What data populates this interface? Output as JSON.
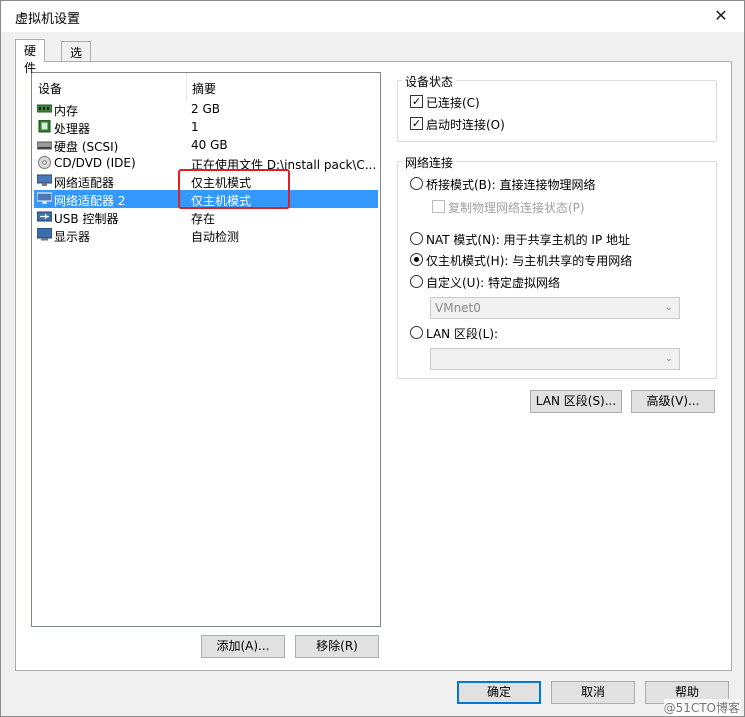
{
  "window": {
    "title": "虚拟机设置",
    "close_glyph": "✕"
  },
  "tabs": [
    {
      "label": "硬件",
      "active": true
    },
    {
      "label": "选项",
      "active": false
    }
  ],
  "device_list": {
    "columns": {
      "device": "设备",
      "summary": "摘要"
    },
    "rows": [
      {
        "name": "内存",
        "summary": "2 GB",
        "icon": "memory-icon"
      },
      {
        "name": "处理器",
        "summary": "1",
        "icon": "processor-icon"
      },
      {
        "name": "硬盘 (SCSI)",
        "summary": "40 GB",
        "icon": "hard-disk-icon"
      },
      {
        "name": "CD/DVD (IDE)",
        "summary": "正在使用文件 D:\\install pack\\C...",
        "icon": "cd-dvd-icon"
      },
      {
        "name": "网络适配器",
        "summary": "仅主机模式",
        "icon": "network-adapter-icon"
      },
      {
        "name": "网络适配器 2",
        "summary": "仅主机模式",
        "icon": "network-adapter-icon",
        "selected": true
      },
      {
        "name": "USB 控制器",
        "summary": "存在",
        "icon": "usb-icon"
      },
      {
        "name": "显示器",
        "summary": "自动检测",
        "icon": "display-icon"
      }
    ],
    "add_button": "添加(A)...",
    "remove_button": "移除(R)"
  },
  "device_status": {
    "title": "设备状态",
    "connected": {
      "label": "已连接(C)",
      "checked": true
    },
    "connect_at_power_on": {
      "label": "启动时连接(O)",
      "checked": true
    }
  },
  "network_connection": {
    "title": "网络连接",
    "bridged": {
      "label": "桥接模式(B): 直接连接物理网络",
      "selected": false
    },
    "replicate": {
      "label": "复制物理网络连接状态(P)",
      "checked": false
    },
    "nat": {
      "label": "NAT 模式(N): 用于共享主机的 IP 地址",
      "selected": false
    },
    "host_only": {
      "label": "仅主机模式(H): 与主机共享的专用网络",
      "selected": true
    },
    "custom": {
      "label": "自定义(U): 特定虚拟网络",
      "selected": false
    },
    "custom_value": "VMnet0",
    "lan_segment": {
      "label": "LAN 区段(L):",
      "selected": false
    },
    "lan_segment_value": ""
  },
  "lan_segments_button": "LAN 区段(S)...",
  "advanced_button": "高级(V)...",
  "footer": {
    "ok": "确定",
    "cancel": "取消",
    "help": "帮助"
  },
  "watermark": "@51CTO博客",
  "colors": {
    "selection": "#3399ff",
    "highlight_box": "#e02020",
    "primary_border": "#0078d7"
  }
}
